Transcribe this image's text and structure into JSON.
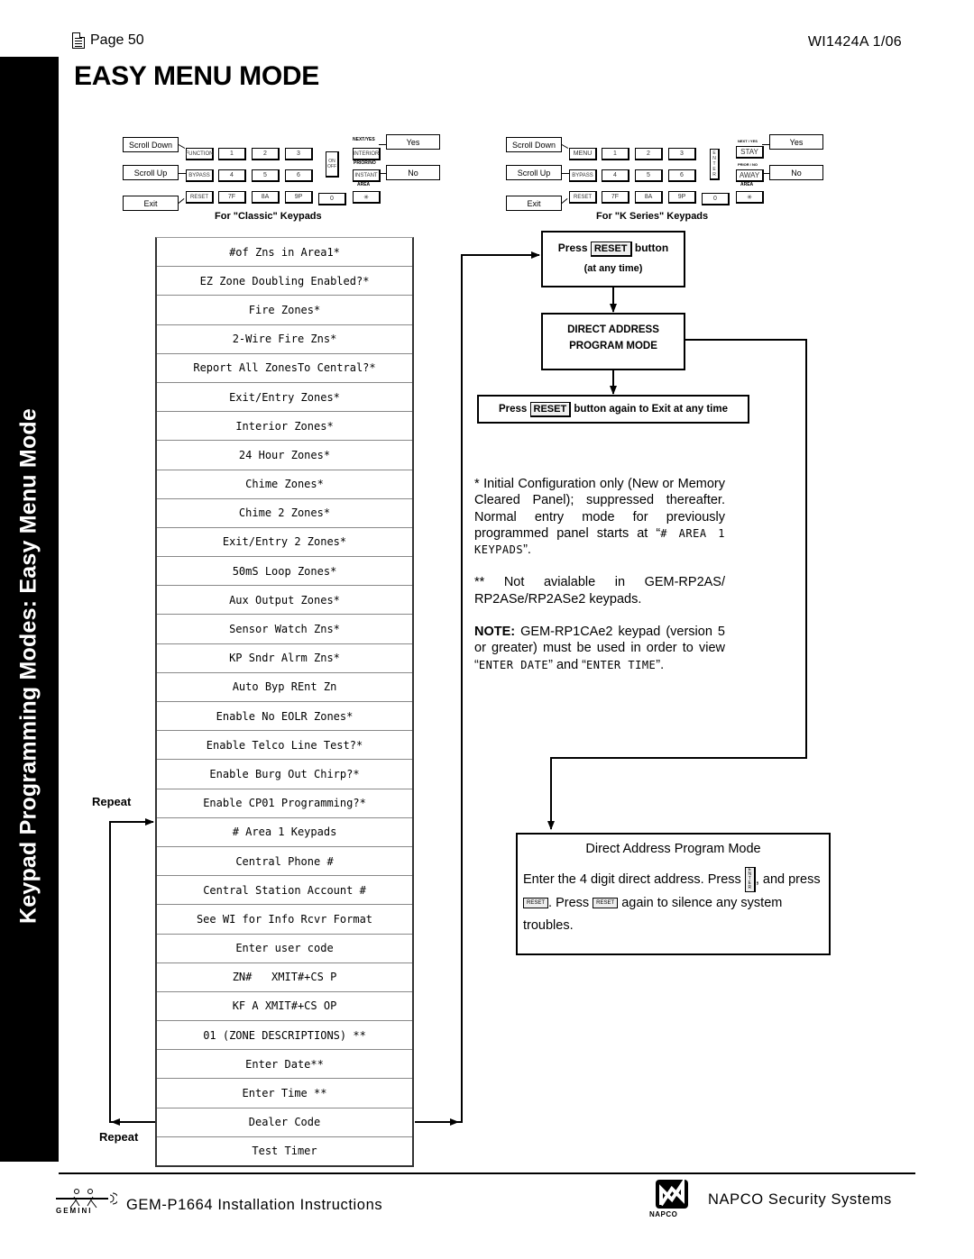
{
  "header": {
    "page_label": "Page 50",
    "doc_id": "WI1424A  1/06",
    "title": "EASY MENU MODE",
    "sidebar_text": "Keypad Programming Modes: Easy Menu Mode"
  },
  "keypads": {
    "classic": {
      "caption": "For \"Classic\" Keypads",
      "labels": {
        "scroll_down": "Scroll Down",
        "scroll_up": "Scroll Up",
        "exit": "Exit",
        "yes": "Yes",
        "no": "No"
      },
      "keys": {
        "function": "FUNCTION",
        "bypass": "BYPASS",
        "reset": "RESET",
        "k1": "1",
        "k2": "2",
        "k3": "3",
        "k4": "4",
        "k5": "5",
        "k6": "6",
        "k7": "7F",
        "k8": "8A",
        "k9": "9P",
        "k0": "0",
        "on": "ON",
        "off": "OFF",
        "interior": "INTERIOR",
        "instant": "INSTANT",
        "star": "✳",
        "next_yes": "NEXT/YES",
        "prior_no": "PRIOR/NO",
        "area": "AREA"
      }
    },
    "k_series": {
      "caption": "For \"K Series\" Keypads",
      "labels": {
        "scroll_down": "Scroll Down",
        "scroll_up": "Scroll Up",
        "exit": "Exit",
        "yes": "Yes",
        "no": "No"
      },
      "keys": {
        "menu": "MENU",
        "bypass": "BYPASS",
        "reset": "RESET",
        "k1": "1",
        "k2": "2",
        "k3": "3",
        "k4": "4",
        "k5": "5",
        "k6": "6",
        "k7": "7F",
        "k8": "8A",
        "k9": "9P",
        "k0": "0",
        "enter": "ENTER",
        "stay": "STAY",
        "away": "AWAY",
        "star": "✳",
        "next_yes": "NEXT / YES",
        "prior_no": "PRIOR / NO",
        "area": "AREA"
      }
    }
  },
  "menu_items": [
    "#of Zns in Area1*",
    "EZ Zone Doubling Enabled?*",
    "Fire Zones*",
    "2-Wire Fire Zns*",
    "Report All ZonesTo Central?*",
    "Exit/Entry Zones*",
    "Interior Zones*",
    "24 Hour Zones*",
    "Chime Zones*",
    "Chime 2 Zones*",
    "Exit/Entry 2 Zones*",
    "50mS Loop Zones*",
    "Aux Output Zones*",
    "Sensor Watch Zns*",
    "KP Sndr Alrm Zns*",
    "Auto Byp REnt Zn",
    "Enable No EOLR Zones*",
    "Enable Telco Line Test?*",
    "Enable Burg Out Chirp?*",
    "Enable CP01 Programming?*",
    "# Area 1 Keypads",
    "Central Phone #",
    "Central Station Account #",
    "See WI for Info Rcvr Format",
    "Enter user code",
    "ZN#   XMIT#+CS P",
    "KF A XMIT#+CS OP",
    "01 (ZONE DESCRIPTIONS) **",
    "Enter Date**",
    "Enter Time **",
    "Dealer Code",
    "Test Timer"
  ],
  "repeat_labels": {
    "top": "Repeat",
    "bottom": "Repeat"
  },
  "flow": {
    "press_reset": {
      "press": "Press",
      "key": "RESET",
      "button": "button",
      "sub": "(at any time)"
    },
    "direct_address": {
      "line1": "DIRECT ADDRESS",
      "line2": "PROGRAM MODE"
    },
    "exit_box": {
      "press": "Press",
      "key": "RESET",
      "rest": "button again to Exit at any time"
    }
  },
  "notes": {
    "note1_prefix": "*   Initial Configuration only (New or Memory Cleared Panel); suppressed thereafter.  Normal entry mode for previously programmed panel starts at “",
    "note1_lcd": "# AREA 1 KEYPADS",
    "note1_suffix": "”.",
    "note2": "**  Not avialable in GEM-RP2AS/ RP2ASe/RP2ASe2 keypads.",
    "note3_label": "NOTE:",
    "note3_text1": " GEM-RP1CAe2 keypad (version 5 or greater) must be used in order to view “",
    "note3_lcd1": "ENTER DATE",
    "note3_text2": "” and “",
    "note3_lcd2": "ENTER TIME",
    "note3_text3": "”."
  },
  "direct_address_box": {
    "title": "Direct Address Program Mode",
    "text1": "Enter the 4 digit direct address.  Press ",
    "enter_key": "ENTER",
    "text2": ", and press ",
    "reset_key": "RESET",
    "text3": ".  Press ",
    "text4": " again to silence any system troubles."
  },
  "footer": {
    "left": "GEM-P1664 Installation Instructions",
    "gemini_word": "GEMINI",
    "right": "NAPCO Security Systems",
    "napco_word": "NAPCO"
  }
}
